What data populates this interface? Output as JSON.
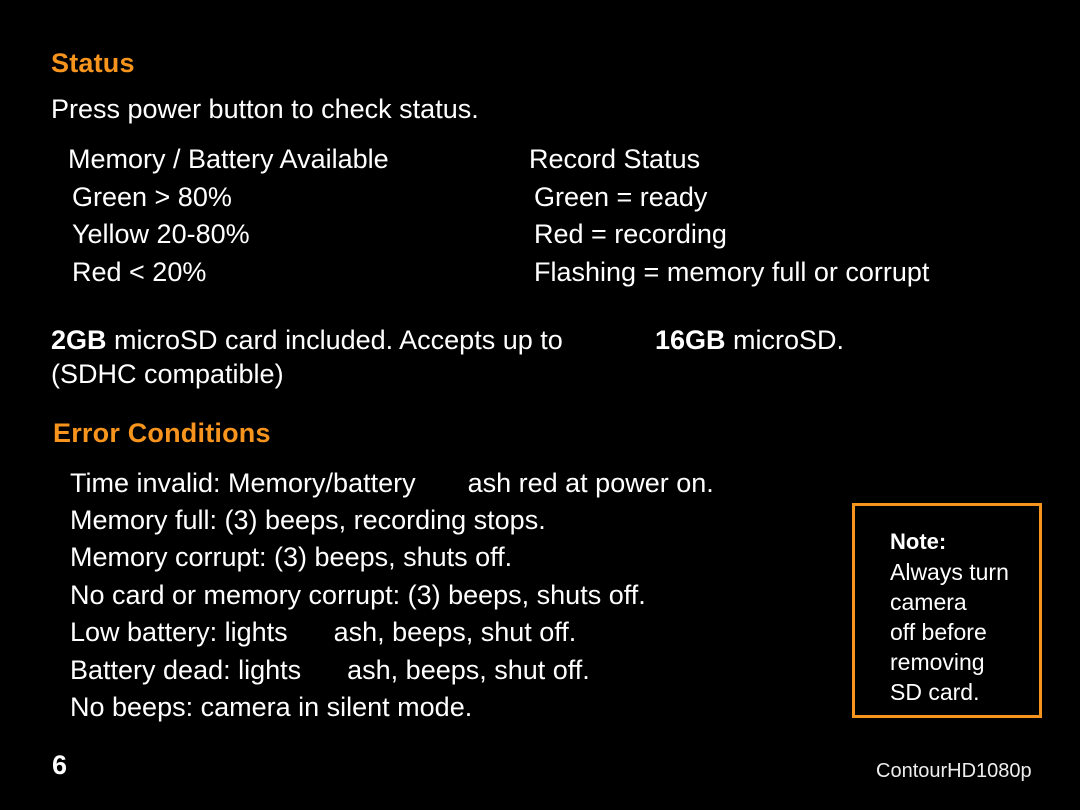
{
  "status": {
    "heading": "Status",
    "intro": "Press power button to check status.",
    "memory_battery": {
      "title": "Memory / Battery Available",
      "items": [
        "Green > 80%",
        "Yellow 20-80%",
        "Red < 20%"
      ]
    },
    "record_status": {
      "title": "Record Status",
      "items": [
        "Green = ready",
        "Red = recording",
        "Flashing = memory full or corrupt"
      ]
    }
  },
  "card_info": {
    "included_size": "2GB",
    "included_text": " microSD card included. Accepts up to",
    "max_size": "16GB",
    "max_text": " microSD.",
    "line2": "(SDHC compatible)"
  },
  "errors": {
    "heading": "Error Conditions",
    "items": [
      {
        "before": "Time invalid: Memory/battery",
        "after": "ash red at power on."
      },
      {
        "before": "Memory full: (3) beeps, recording stops.",
        "after": ""
      },
      {
        "before": "Memory corrupt: (3) beeps, shuts off.",
        "after": ""
      },
      {
        "before": "No card or memory corrupt: (3) beeps, shuts off.",
        "after": ""
      },
      {
        "before": "Low battery: lights",
        "after": "ash, beeps, shut off."
      },
      {
        "before": "Battery dead: lights",
        "after": "ash, beeps, shut off."
      },
      {
        "before": "No beeps: camera in silent mode.",
        "after": ""
      }
    ]
  },
  "note": {
    "title": "Note:",
    "lines": [
      "Always turn",
      "camera",
      "off before",
      "removing",
      "SD card."
    ]
  },
  "footer": {
    "page_number": "6",
    "product": "ContourHD1080p"
  },
  "colors": {
    "accent": "#f7941d",
    "background": "#000000",
    "text": "#ffffff"
  }
}
